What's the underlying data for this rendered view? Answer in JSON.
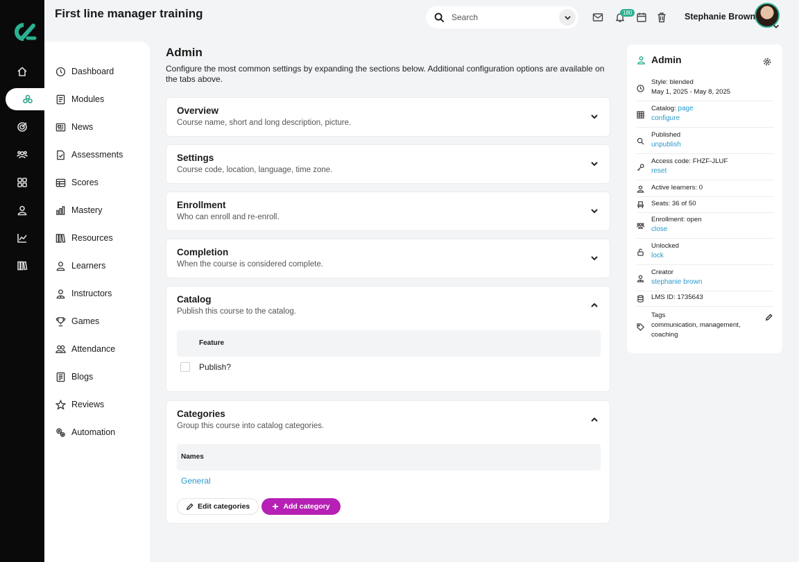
{
  "header": {
    "course_title": "First line manager training",
    "search_placeholder": "Search",
    "notification_count": "180",
    "user_name": "Stephanie Brown"
  },
  "nav": {
    "items": [
      {
        "label": "Dashboard",
        "icon": "dashboard-icon"
      },
      {
        "label": "Modules",
        "icon": "modules-icon"
      },
      {
        "label": "News",
        "icon": "news-icon"
      },
      {
        "label": "Assessments",
        "icon": "assessments-icon"
      },
      {
        "label": "Scores",
        "icon": "scores-icon"
      },
      {
        "label": "Mastery",
        "icon": "mastery-icon"
      },
      {
        "label": "Resources",
        "icon": "resources-icon"
      },
      {
        "label": "Learners",
        "icon": "learners-icon"
      },
      {
        "label": "Instructors",
        "icon": "instructors-icon"
      },
      {
        "label": "Games",
        "icon": "games-icon"
      },
      {
        "label": "Attendance",
        "icon": "attendance-icon"
      },
      {
        "label": "Blogs",
        "icon": "blogs-icon"
      },
      {
        "label": "Reviews",
        "icon": "reviews-icon"
      },
      {
        "label": "Automation",
        "icon": "automation-icon"
      }
    ]
  },
  "main": {
    "title": "Admin",
    "description": "Configure the most common settings by expanding the sections below. Additional configuration options are available on the tabs above.",
    "sections": {
      "overview": {
        "title": "Overview",
        "subtitle": "Course name, short and long description, picture."
      },
      "settings": {
        "title": "Settings",
        "subtitle": "Course code, location, language, time zone."
      },
      "enrollment": {
        "title": "Enrollment",
        "subtitle": "Who can enroll and re-enroll."
      },
      "completion": {
        "title": "Completion",
        "subtitle": "When the course is considered complete."
      },
      "catalog": {
        "title": "Catalog",
        "subtitle": "Publish this course to the catalog.",
        "column_header": "Feature",
        "row_label": "Publish?"
      },
      "categories": {
        "title": "Categories",
        "subtitle": "Group this course into catalog categories.",
        "column_header": "Names",
        "row_value": "General",
        "edit_label": "Edit categories",
        "add_label": "Add category"
      }
    }
  },
  "info": {
    "title": "Admin",
    "style_label": "Style: blended",
    "dates": "May 1, 2025 - May 8, 2025",
    "catalog_label": "Catalog:",
    "catalog_link1": "page",
    "catalog_link2": "configure",
    "published_label": "Published",
    "published_link": "unpublish",
    "access_code_label": "Access code: FHZF-JLUF",
    "access_code_link": "reset",
    "active_learners": "Active learners: 0",
    "seats": "Seats: 36 of 50",
    "enrollment_label": "Enrollment: open",
    "enrollment_link": "close",
    "unlocked_label": "Unlocked",
    "unlocked_link": "lock",
    "creator_label": "Creator",
    "creator_link": "stephanie brown",
    "lms_id": "LMS ID: 1735643",
    "tags_label": "Tags",
    "tags_value": "communication, management, coaching"
  },
  "colors": {
    "accent": "#2bb18f",
    "primary_button": "#b620b4",
    "link": "#2a9bc9",
    "rail": "#0a0a0a"
  }
}
